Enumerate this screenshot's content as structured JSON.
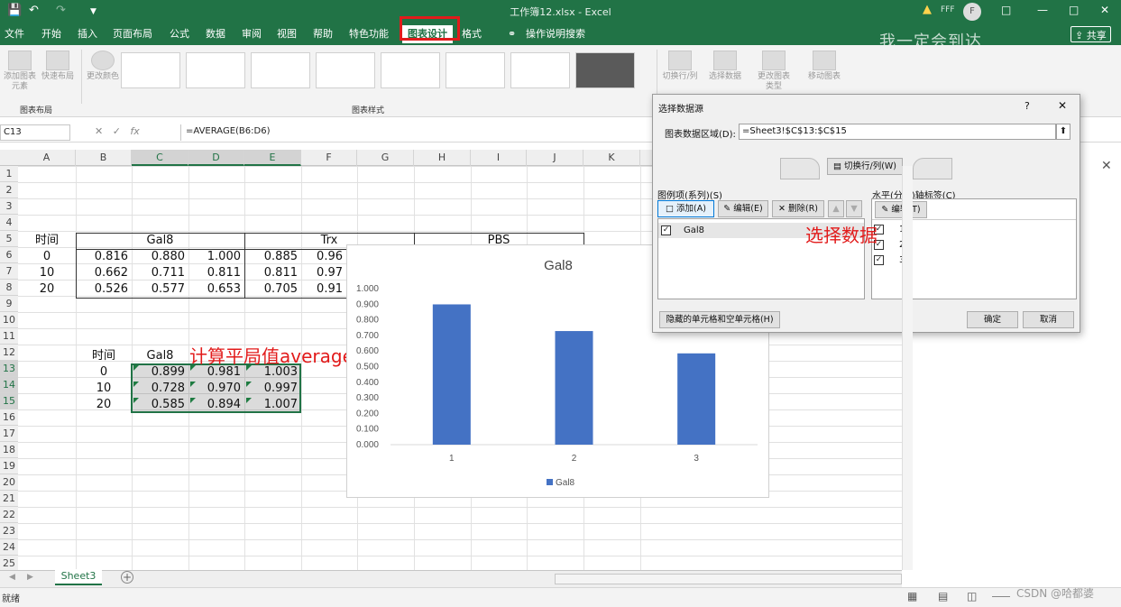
{
  "window": {
    "title": "工作簿12.xlsx - Excel",
    "user_initials": "F",
    "user_name": "FFF"
  },
  "menu": {
    "tabs": [
      "文件",
      "开始",
      "插入",
      "页面布局",
      "公式",
      "数据",
      "审阅",
      "视图",
      "帮助",
      "特色功能",
      "图表设计",
      "格式"
    ],
    "active": "图表设计",
    "tell_me": "操作说明搜索",
    "share": "共享",
    "watermark_text": "我一定会到达"
  },
  "ribbon": {
    "add_element": "添加图表元素",
    "quick_layout": "快速布局",
    "change_colors": "更改颜色",
    "group_layout": "图表布局",
    "group_styles": "图表样式",
    "switch_row_col": "切换行/列",
    "select_data": "选择数据",
    "change_type": "更改图表类型",
    "move_chart": "移动图表"
  },
  "formula_bar": {
    "name_box": "C13",
    "fx": "fx",
    "formula": "=AVERAGE(B6:D6)"
  },
  "columns": [
    "A",
    "B",
    "C",
    "D",
    "E",
    "F",
    "G",
    "H",
    "I",
    "J",
    "K"
  ],
  "rows": [
    "1",
    "2",
    "3",
    "4",
    "5",
    "6",
    "7",
    "8",
    "9",
    "10",
    "11",
    "12",
    "13",
    "14",
    "15",
    "16",
    "17",
    "18",
    "19",
    "20",
    "21",
    "22",
    "23",
    "24",
    "25"
  ],
  "sheet": {
    "header_time": "时间",
    "header_gal8": "Gal8",
    "header_trx": "Trx",
    "header_pbs": "PBS",
    "table1": [
      {
        "t": "0",
        "b": "0.816",
        "c": "0.880",
        "d": "1.000",
        "e": "0.885",
        "f": "0.96"
      },
      {
        "t": "10",
        "b": "0.662",
        "c": "0.711",
        "d": "0.811",
        "e": "0.811",
        "f": "0.97"
      },
      {
        "t": "20",
        "b": "0.526",
        "c": "0.577",
        "d": "0.653",
        "e": "0.705",
        "f": "0.91"
      }
    ],
    "t2_time": "时间",
    "t2_gal8": "Gal8",
    "table2": [
      {
        "t": "0",
        "c": "0.899",
        "d": "0.981",
        "e": "1.003"
      },
      {
        "t": "10",
        "c": "0.728",
        "d": "0.970",
        "e": "0.997"
      },
      {
        "t": "20",
        "c": "0.585",
        "d": "0.894",
        "e": "1.007"
      }
    ]
  },
  "annotations": {
    "average": "计算平局值average",
    "select_data": "选择数据"
  },
  "chart_data": {
    "type": "bar",
    "title": "Gal8",
    "categories": [
      "1",
      "2",
      "3"
    ],
    "series": [
      {
        "name": "Gal8",
        "values": [
          0.899,
          0.728,
          0.585
        ]
      }
    ],
    "ylim": [
      0,
      1.0
    ],
    "yticks": [
      "0.000",
      "0.100",
      "0.200",
      "0.300",
      "0.400",
      "0.500",
      "0.600",
      "0.700",
      "0.800",
      "0.900",
      "1.000"
    ],
    "grid": false,
    "legend": "bottom",
    "color": "#4472c4"
  },
  "dialog": {
    "title": "选择数据源",
    "help": "?",
    "close": "✕",
    "range_label": "图表数据区域(D):",
    "range_value": "=Sheet3!$C$13:$C$15",
    "switch_label": "切换行/列(W)",
    "legend_label": "图例项(系列)(S)",
    "add": "添加(A)",
    "edit": "编辑(E)",
    "remove": "删除(R)",
    "series": [
      "Gal8"
    ],
    "axis_label": "水平(分类)轴标签(C)",
    "axis_edit": "编辑(T)",
    "axis_items": [
      "1",
      "2",
      "3"
    ],
    "hidden_cells": "隐藏的单元格和空单元格(H)",
    "ok": "确定",
    "cancel": "取消"
  },
  "bottom": {
    "sheet_tab": "Sheet3",
    "status": "就绪",
    "watermark": "CSDN @哈都婆"
  }
}
